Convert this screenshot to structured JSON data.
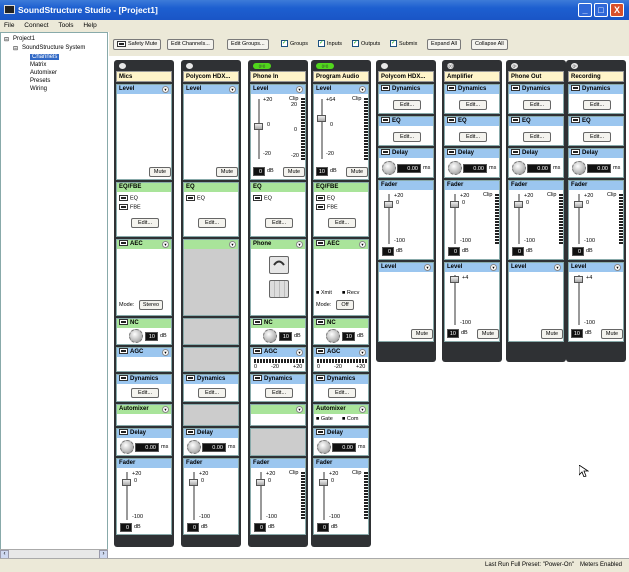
{
  "window": {
    "title": "SoundStructure Studio - [Project1]",
    "buttons": [
      "_",
      "□",
      "X"
    ]
  },
  "menu": [
    "File",
    "Connect",
    "Tools",
    "Help"
  ],
  "tree": {
    "root": "Project1",
    "system": "SoundStructure System",
    "items": [
      "Channels",
      "Matrix",
      "Automixer",
      "Presets",
      "Wiring"
    ],
    "selected": "Channels"
  },
  "toolbar": {
    "safety_mute": "Safety Mute",
    "edit_channels": "Edit Channels...",
    "edit_groups": "Edit Groups...",
    "checkboxes": [
      {
        "label": "Groups",
        "checked": true
      },
      {
        "label": "Inputs",
        "checked": true
      },
      {
        "label": "Outputs",
        "checked": true
      },
      {
        "label": "Submix",
        "checked": true
      }
    ],
    "expand_all": "Expand All",
    "collapse_all": "Collapse All"
  },
  "common": {
    "level": "Level",
    "mute": "Mute",
    "edit": "Edit...",
    "eq": "EQ",
    "eq_fbe": "EQ/FBE",
    "fbe": "FBE",
    "aec": "AEC",
    "nc": "NC",
    "agc": "AGC",
    "dynamics": "Dynamics",
    "automixer": "Automixer",
    "delay": "Delay",
    "fader": "Fader",
    "phone": "Phone",
    "db": "dB",
    "ms": "ms",
    "mode": "Mode:",
    "gate": "Gate",
    "com": "Com",
    "xmit": "Xmit",
    "recv": "Recv",
    "clip": "Clip"
  },
  "channels": [
    {
      "name": "Mics",
      "mode": "Stereo",
      "nc_value": "10",
      "delay": "0.00",
      "fader": "0"
    },
    {
      "name": "Polycom HDX...",
      "delay": "0.00",
      "fader": "0"
    },
    {
      "name": "Phone In",
      "level": "0",
      "nc_value": "10",
      "fader": "0"
    },
    {
      "name": "Program Audio",
      "level": "10",
      "mode": "Off",
      "nc_value": "10",
      "delay": "0.00",
      "fader": "0"
    },
    {
      "name": "Polycom HDX...",
      "delay": "0.00",
      "fader": "0"
    },
    {
      "name": "Amplifier",
      "delay": "0.00",
      "fader": "0",
      "level": "10"
    },
    {
      "name": "Phone Out",
      "delay": "0.00",
      "fader": "0"
    },
    {
      "name": "Recording",
      "delay": "0.00",
      "fader": "0",
      "level": "10"
    }
  ],
  "scales": {
    "p20": "+20",
    "p4": "+4",
    "zero": "0",
    "m20": "-20",
    "m100": "-100",
    "p64": "+64",
    "agc_left": "0",
    "agc_mid": "-20",
    "agc_right": "+20",
    "meter_top": "20",
    "meter_mid": "0",
    "meter_bot": "-20"
  },
  "status": {
    "preset": "Last Run Full Preset: \"Power-On\"",
    "meters": "Meters Enabled"
  }
}
